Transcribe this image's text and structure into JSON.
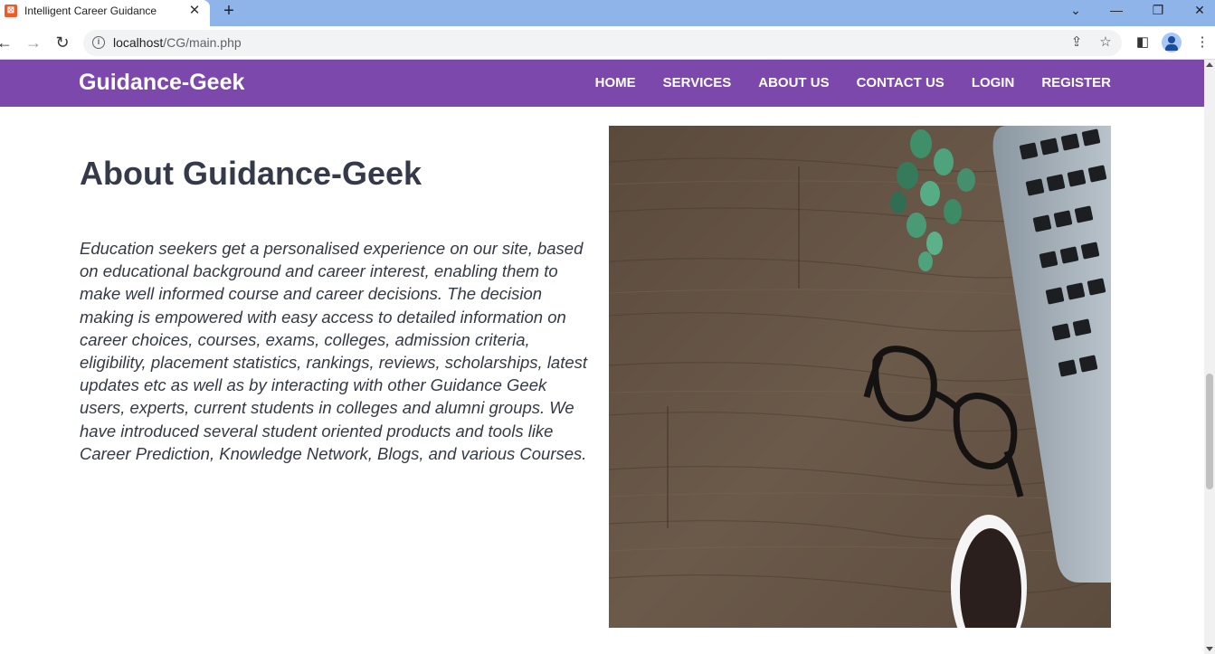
{
  "browser": {
    "tab_title": "Intelligent Career Guidance",
    "tab_close": "✕",
    "new_tab": "+",
    "url_host": "localhost",
    "url_path": "/CG/main.php",
    "controls": {
      "tab_search": "⌄",
      "minimize": "—",
      "restore": "❐",
      "close": "✕"
    }
  },
  "header": {
    "brand": "Guidance-Geek",
    "nav": [
      "HOME",
      "SERVICES",
      "ABOUT US",
      "CONTACT US",
      "LOGIN",
      "REGISTER"
    ],
    "color": "#7c48ab"
  },
  "about": {
    "title": "About Guidance-Geek",
    "text": "Education seekers get a personalised experience on our site, based on educational background and career interest, enabling them to make well informed course and career decisions. The decision making is empowered with easy access to detailed information on career choices, courses, exams, colleges, admission criteria, eligibility, placement statistics, rankings, reviews, scholarships, latest updates etc as well as by interacting with other Guidance Geek users, experts, current students in colleges and alumni groups. We have introduced several student oriented products and tools like Career Prediction, Knowledge Network, Blogs, and various Courses."
  },
  "image": {
    "subject": "wooden-desk-with-laptop-glasses-coffee-and-plant"
  }
}
